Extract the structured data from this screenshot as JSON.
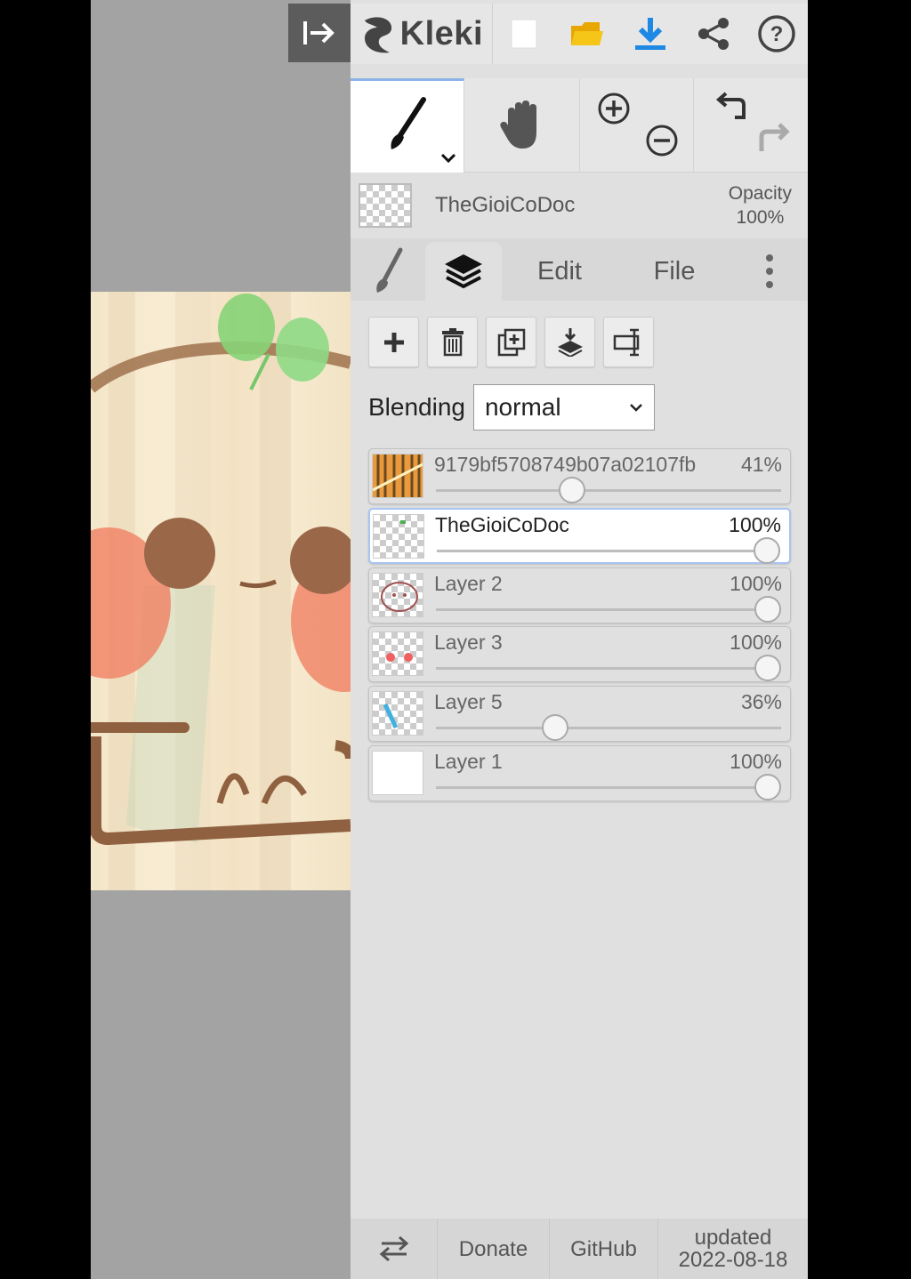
{
  "app": {
    "name": "Kleki"
  },
  "brush": {
    "name": "TheGioiCoDoc",
    "opacity_label": "Opacity",
    "opacity_value": "100%"
  },
  "tabs": {
    "edit": "Edit",
    "file": "File"
  },
  "blending": {
    "label": "Blending",
    "value": "normal"
  },
  "layers": [
    {
      "name": "9179bf5708749b07a02107fb",
      "opacity": "41%",
      "level": 0.41
    },
    {
      "name": "TheGioiCoDoc",
      "opacity": "100%",
      "level": 1.0
    },
    {
      "name": "Layer 2",
      "opacity": "100%",
      "level": 1.0
    },
    {
      "name": "Layer 3",
      "opacity": "100%",
      "level": 1.0
    },
    {
      "name": "Layer 5",
      "opacity": "36%",
      "level": 0.36
    },
    {
      "name": "Layer 1",
      "opacity": "100%",
      "level": 1.0
    }
  ],
  "footer": {
    "donate": "Donate",
    "github": "GitHub",
    "updated_label": "updated",
    "updated_date": "2022-08-18"
  },
  "colors": {
    "accent": "#1e88e5",
    "folder": "#f5c518",
    "panel": "#e0e0e0"
  },
  "icons": [
    "collapse-panel-icon",
    "kleki-logo-icon",
    "new-image-icon",
    "open-folder-icon",
    "download-icon",
    "share-icon",
    "help-icon",
    "brush-icon",
    "hand-icon",
    "zoom-in-icon",
    "zoom-out-icon",
    "undo-icon",
    "redo-icon",
    "layers-icon",
    "more-icon",
    "add-layer-icon",
    "delete-layer-icon",
    "duplicate-layer-icon",
    "merge-layer-icon",
    "rename-layer-icon",
    "swap-side-icon"
  ]
}
